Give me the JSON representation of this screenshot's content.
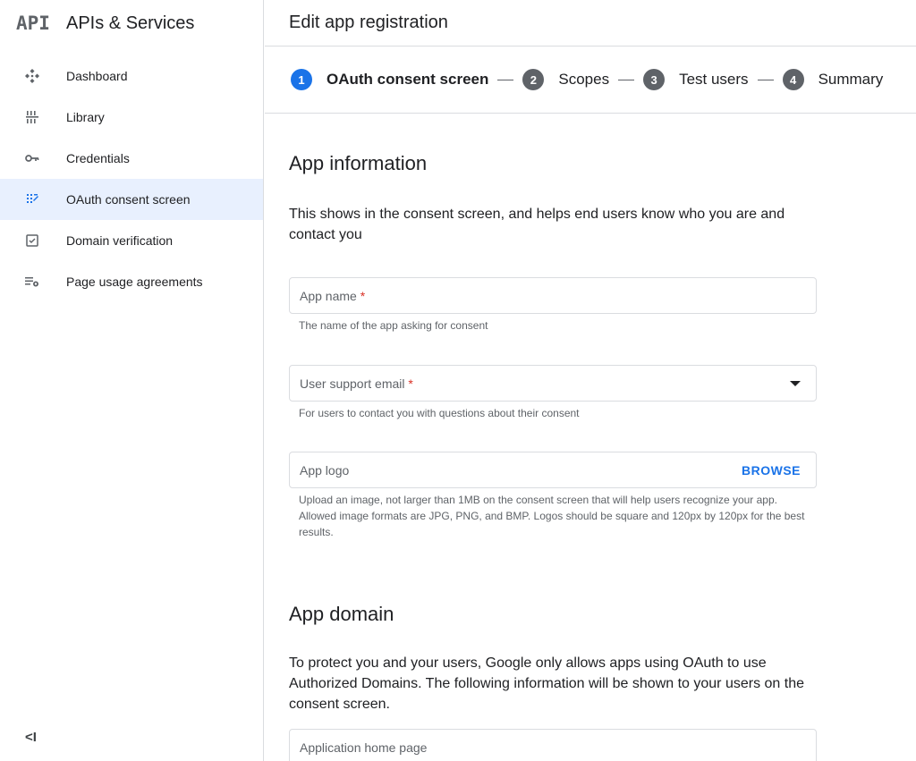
{
  "sidebar": {
    "logo": "API",
    "title": "APIs & Services",
    "items": [
      {
        "label": "Dashboard",
        "icon": "dashboard-icon"
      },
      {
        "label": "Library",
        "icon": "library-icon"
      },
      {
        "label": "Credentials",
        "icon": "key-icon"
      },
      {
        "label": "OAuth consent screen",
        "icon": "consent-icon",
        "active": true
      },
      {
        "label": "Domain verification",
        "icon": "checkbox-icon"
      },
      {
        "label": "Page usage agreements",
        "icon": "settings-list-icon"
      }
    ],
    "collapse_label": "<I"
  },
  "header": {
    "title": "Edit app registration"
  },
  "stepper": {
    "steps": [
      {
        "num": "1",
        "label": "OAuth consent screen",
        "active": true
      },
      {
        "num": "2",
        "label": "Scopes"
      },
      {
        "num": "3",
        "label": "Test users"
      },
      {
        "num": "4",
        "label": "Summary"
      }
    ]
  },
  "app_info": {
    "title": "App information",
    "desc": "This shows in the consent screen, and helps end users know who you are and contact you",
    "app_name": {
      "label": "App name",
      "required": "*",
      "hint": "The name of the app asking for consent"
    },
    "support_email": {
      "label": "User support email",
      "required": "*",
      "hint": "For users to contact you with questions about their consent"
    },
    "app_logo": {
      "label": "App logo",
      "action": "BROWSE",
      "hint": "Upload an image, not larger than 1MB on the consent screen that will help users recognize your app. Allowed image formats are JPG, PNG, and BMP. Logos should be square and 120px by 120px for the best results."
    }
  },
  "app_domain": {
    "title": "App domain",
    "desc": "To protect you and your users, Google only allows apps using OAuth to use Authorized Domains. The following information will be shown to your users on the consent screen.",
    "home_page": {
      "label": "Application home page"
    }
  },
  "colors": {
    "accent": "#1a73e8",
    "active_bg": "#e8f0fe",
    "required": "#d93025"
  }
}
